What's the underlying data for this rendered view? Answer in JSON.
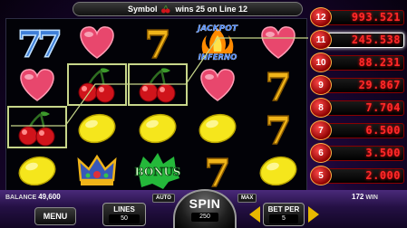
{
  "banner": {
    "symbol_label": "Symbol",
    "win_text": "wins 25 on Line 12",
    "symbol_icon": "cherry-icon"
  },
  "reels": [
    [
      "seven-blue",
      "heart",
      "cherry",
      "lemon"
    ],
    [
      "heart",
      "cherry",
      "lemon",
      "crown"
    ],
    [
      "seven-gold",
      "cherry",
      "lemon",
      "bonus"
    ],
    [
      "jackpot-inferno",
      "heart",
      "lemon",
      "seven-gold"
    ],
    [
      "heart",
      "seven-gold",
      "seven-gold",
      "lemon"
    ]
  ],
  "symbols": {
    "bonus_text": "BONUS",
    "jackpot_line1": "JACKPOT",
    "jackpot_line2": "INFERNO"
  },
  "winning_cells": [
    [
      0,
      2
    ],
    [
      1,
      1
    ],
    [
      2,
      1
    ]
  ],
  "paytable": [
    {
      "line": "12",
      "amount": "993.521"
    },
    {
      "line": "11",
      "amount": "245.538"
    },
    {
      "line": "10",
      "amount": "88.231"
    },
    {
      "line": "9",
      "amount": "29.867"
    },
    {
      "line": "8",
      "amount": "7.704"
    },
    {
      "line": "7",
      "amount": "6.500"
    },
    {
      "line": "6",
      "amount": "3.500"
    },
    {
      "line": "5",
      "amount": "2.000"
    }
  ],
  "active_paytable_line": "11",
  "bottom": {
    "balance_label": "BALANCE",
    "balance_value": "49,600",
    "menu_label": "MENU",
    "lines_label": "LINES",
    "lines_value": "50",
    "auto_label": "AUTO",
    "spin_label": "SPIN",
    "spin_value": "250",
    "max_label": "MAX",
    "bet_label": "BET PER",
    "bet_value": "5",
    "win_value": "172",
    "win_label": "WIN"
  },
  "colors": {
    "accent_red": "#ff2a2a",
    "win_outline": "#c7d68a",
    "background": "#1c0636"
  }
}
